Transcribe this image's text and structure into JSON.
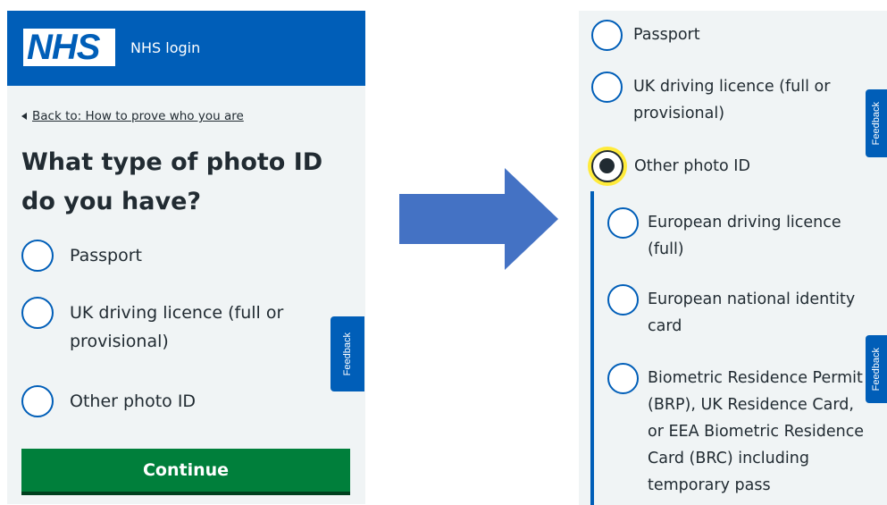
{
  "left": {
    "logo_text": "NHS",
    "service_name": "NHS login",
    "back_link": "Back to: How to prove who you are",
    "heading": "What type of photo ID do you have?",
    "options": [
      {
        "label": "Passport"
      },
      {
        "label": "UK driving licence (full or provisional)"
      },
      {
        "label": "Other photo ID"
      }
    ],
    "continue_label": "Continue",
    "feedback_label": "Feedback"
  },
  "right": {
    "options": [
      {
        "label": "Passport"
      },
      {
        "label": "UK driving licence (full or provisional)"
      },
      {
        "label": "Other photo ID",
        "selected": true
      }
    ],
    "conditional_options": [
      {
        "label": "European driving licence (full)"
      },
      {
        "label": "European national identity card"
      },
      {
        "label": "Biometric Residence Permit (BRP), UK Residence Card, or EEA Biometric Residence Card (BRC) including temporary pass"
      }
    ],
    "feedback_label": "Feedback"
  },
  "colors": {
    "nhs_blue": "#005eb8",
    "button_green": "#007f3b",
    "background": "#f0f4f5",
    "focus_yellow": "#ffeb3b",
    "arrow_blue": "#4472c4"
  }
}
